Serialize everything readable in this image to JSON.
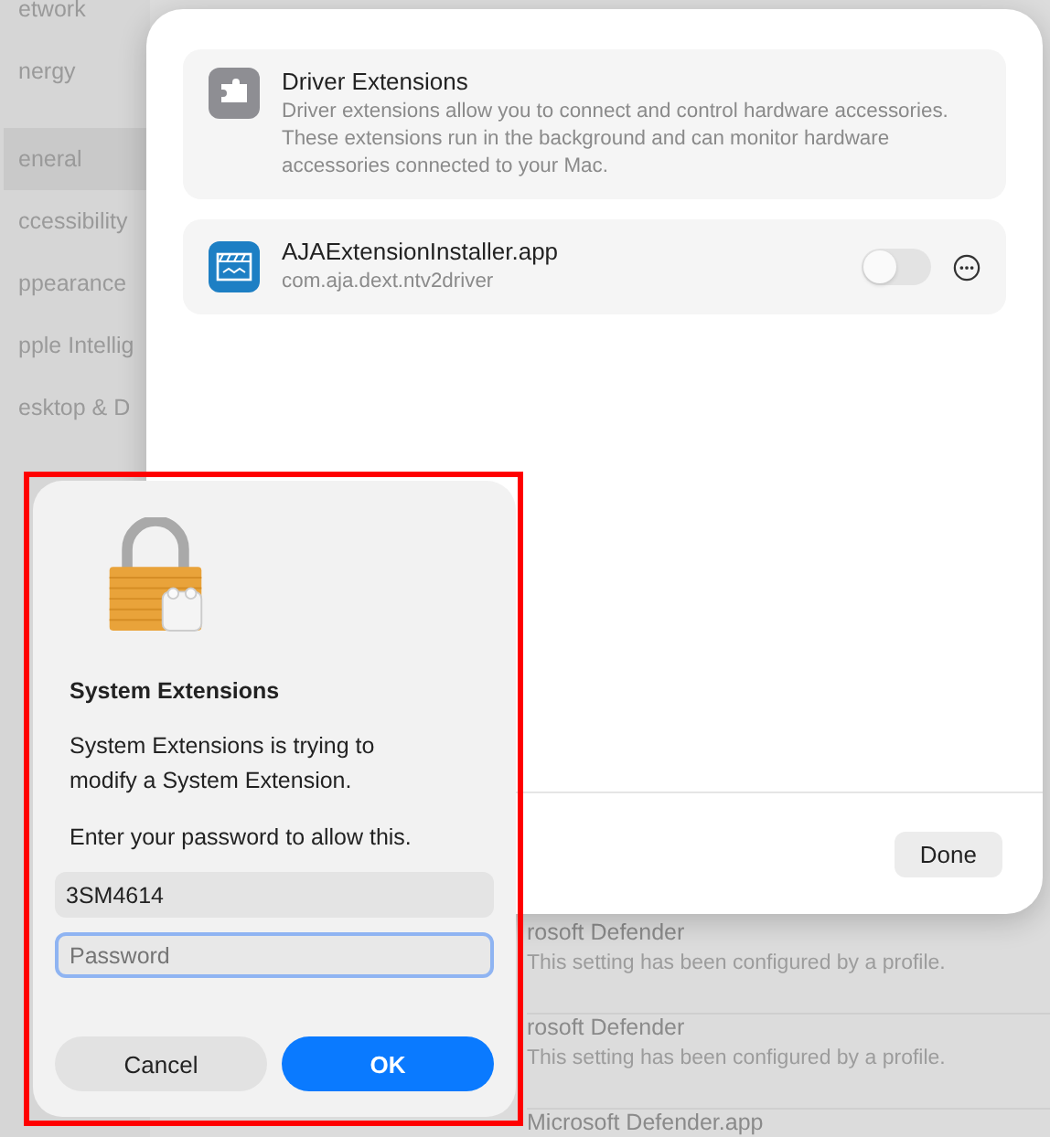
{
  "sidebar": {
    "items": [
      {
        "label": "etwork",
        "selected": false
      },
      {
        "label": "nergy",
        "selected": false
      },
      {
        "label": "eneral",
        "selected": true
      },
      {
        "label": "ccessibility",
        "selected": false
      },
      {
        "label": "ppearance",
        "selected": false
      },
      {
        "label": "pple Intellig",
        "selected": false
      },
      {
        "label": "esktop & D",
        "selected": false
      }
    ]
  },
  "background_list": {
    "rows": [
      {
        "title": "rosoft Defender",
        "subtitle": "This setting has been configured by a profile."
      },
      {
        "title": "rosoft Defender",
        "subtitle": "This setting has been configured by a profile."
      },
      {
        "title": "Microsoft Defender.app"
      }
    ]
  },
  "sheet": {
    "header": {
      "title": "Driver Extensions",
      "description": "Driver extensions allow you to connect and control hardware accessories. These extensions run in the background and can monitor hardware accessories connected to your Mac."
    },
    "extensions": [
      {
        "name": "AJAExtensionInstaller.app",
        "bundle_id": "com.aja.dext.ntv2driver",
        "on": false
      }
    ],
    "done_button": "Done"
  },
  "dialog": {
    "title": "System Extensions",
    "message": "System Extensions is trying to modify a System Extension.",
    "prompt": "Enter your password to allow this.",
    "username": "3SM4614",
    "password_placeholder": "Password",
    "buttons": [
      {
        "label": "Cancel",
        "kind": "secondary"
      },
      {
        "label": "OK",
        "kind": "primary"
      }
    ]
  }
}
